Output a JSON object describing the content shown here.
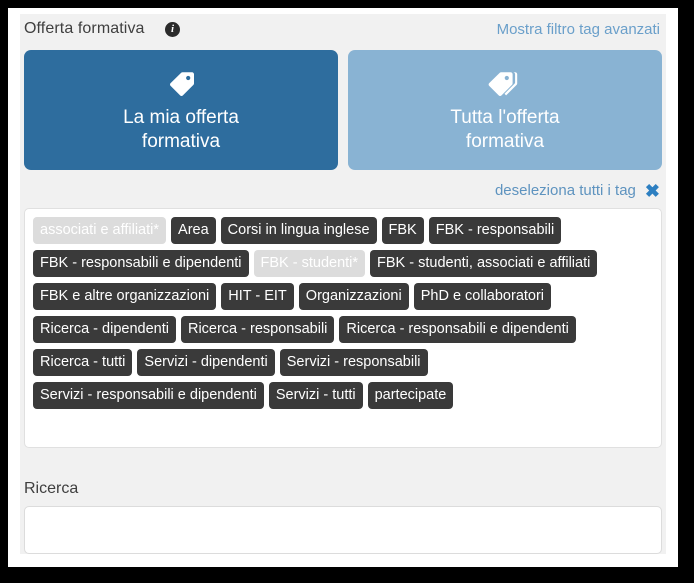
{
  "header": {
    "title": "Offerta formativa",
    "info_icon": "info-circle-icon",
    "advanced_filter_link": "Mostra filtro tag avanzati"
  },
  "buttons": [
    {
      "label_line1": "La mia offerta",
      "label_line2": "formativa",
      "icon": "tag-icon",
      "state": "selected",
      "color": "#2e6d9e"
    },
    {
      "label_line1": "Tutta l'offerta",
      "label_line2": "formativa",
      "icon": "tags-icon",
      "state": "unselected",
      "color": "#89b3d3"
    }
  ],
  "deselect": {
    "label": "deseleziona tutti i tag",
    "icon": "close-x-icon",
    "color": "#2d7fc1"
  },
  "tags": [
    {
      "label": "associati e affiliati*",
      "selected": false
    },
    {
      "label": "Area",
      "selected": true
    },
    {
      "label": "Corsi in lingua inglese",
      "selected": true
    },
    {
      "label": "FBK",
      "selected": true
    },
    {
      "label": "FBK - responsabili",
      "selected": true
    },
    {
      "label": "FBK - responsabili e dipendenti",
      "selected": true
    },
    {
      "label": "FBK - studenti*",
      "selected": false
    },
    {
      "label": "FBK - studenti, associati e affiliati",
      "selected": true
    },
    {
      "label": "FBK e altre organizzazioni",
      "selected": true
    },
    {
      "label": "HIT - EIT",
      "selected": true
    },
    {
      "label": "Organizzazioni",
      "selected": true
    },
    {
      "label": "PhD e collaboratori",
      "selected": true
    },
    {
      "label": "Ricerca - dipendenti",
      "selected": true
    },
    {
      "label": "Ricerca - responsabili",
      "selected": true
    },
    {
      "label": "Ricerca - responsabili e dipendenti",
      "selected": true
    },
    {
      "label": "Ricerca - tutti",
      "selected": true
    },
    {
      "label": "Servizi - dipendenti",
      "selected": true
    },
    {
      "label": "Servizi - responsabili",
      "selected": true
    },
    {
      "label": "Servizi - responsabili e dipendenti",
      "selected": true
    },
    {
      "label": "Servizi - tutti",
      "selected": true
    },
    {
      "label": "partecipate",
      "selected": true
    }
  ],
  "search": {
    "label": "Ricerca",
    "value": "",
    "placeholder": ""
  }
}
